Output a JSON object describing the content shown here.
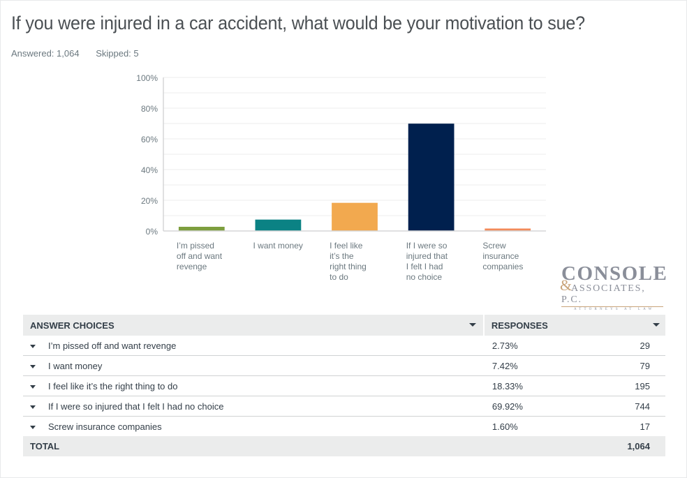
{
  "question": {
    "title": "If you were injured in a car accident, what would be your motivation to sue?",
    "answered_label": "Answered: 1,064",
    "skipped_label": "Skipped: 5"
  },
  "logo": {
    "line1": "CONSOLE",
    "ampersand": "&",
    "line2": "ASSOCIATES, P.C.",
    "line3": "ATTORNEYS AT LAW"
  },
  "chart_data": {
    "type": "bar",
    "title": "",
    "xlabel": "",
    "ylabel": "",
    "ylim": [
      0,
      100
    ],
    "yticks": [
      0,
      20,
      40,
      60,
      80,
      100
    ],
    "ytick_labels": [
      "0%",
      "20%",
      "40%",
      "60%",
      "80%",
      "100%"
    ],
    "grid": true,
    "grid_step": 10,
    "categories": [
      "I’m pissed off and want revenge",
      "I want money",
      "I feel like it’s the right thing to do",
      "If I were so injured that I felt I had no choice",
      "Screw insurance companies"
    ],
    "category_label_lines": [
      [
        "I’m pissed",
        "off and want",
        "revenge"
      ],
      [
        "I want money"
      ],
      [
        "I feel like",
        "it’s the",
        "right thing",
        "to do"
      ],
      [
        "If I were so",
        "injured that",
        "I felt I had",
        "no choice"
      ],
      [
        "Screw",
        "insurance",
        "companies"
      ]
    ],
    "values": [
      2.73,
      7.42,
      18.33,
      69.92,
      1.6
    ],
    "colors": [
      "#7d9e3e",
      "#0b8284",
      "#f2a94f",
      "#00204e",
      "#f28a5a"
    ]
  },
  "table": {
    "headers": {
      "answer_choices": "ANSWER CHOICES",
      "responses": "RESPONSES"
    },
    "rows": [
      {
        "choice": "I’m pissed off and want revenge",
        "percent": "2.73%",
        "count": "29"
      },
      {
        "choice": "I want money",
        "percent": "7.42%",
        "count": "79"
      },
      {
        "choice": "I feel like it’s the right thing to do",
        "percent": "18.33%",
        "count": "195"
      },
      {
        "choice": "If I were so injured that I felt I had no choice",
        "percent": "69.92%",
        "count": "744"
      },
      {
        "choice": "Screw insurance companies",
        "percent": "1.60%",
        "count": "17"
      }
    ],
    "total_label": "TOTAL",
    "total_count": "1,064"
  }
}
